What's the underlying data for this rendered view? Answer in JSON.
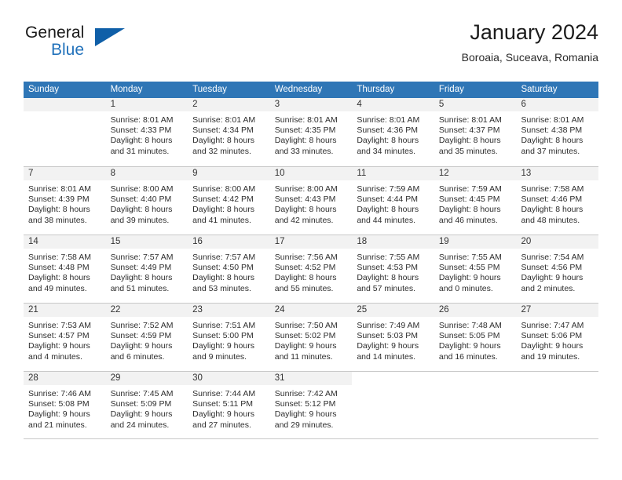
{
  "brand": {
    "name_top": "General",
    "name_bottom": "Blue",
    "triangle_color": "#0f5fa8",
    "blue_color": "#2272bb"
  },
  "header": {
    "title": "January 2024",
    "subtitle": "Boroaia, Suceava, Romania"
  },
  "theme": {
    "header_bg": "#2f76b6",
    "daynum_bg": "#f2f2f2",
    "grid_line": "#c8c8c8"
  },
  "weekdays": [
    "Sunday",
    "Monday",
    "Tuesday",
    "Wednesday",
    "Thursday",
    "Friday",
    "Saturday"
  ],
  "weeks": [
    [
      {
        "day": "",
        "sunrise": "",
        "sunset": "",
        "daylight1": "",
        "daylight2": ""
      },
      {
        "day": "1",
        "sunrise": "Sunrise: 8:01 AM",
        "sunset": "Sunset: 4:33 PM",
        "daylight1": "Daylight: 8 hours",
        "daylight2": "and 31 minutes."
      },
      {
        "day": "2",
        "sunrise": "Sunrise: 8:01 AM",
        "sunset": "Sunset: 4:34 PM",
        "daylight1": "Daylight: 8 hours",
        "daylight2": "and 32 minutes."
      },
      {
        "day": "3",
        "sunrise": "Sunrise: 8:01 AM",
        "sunset": "Sunset: 4:35 PM",
        "daylight1": "Daylight: 8 hours",
        "daylight2": "and 33 minutes."
      },
      {
        "day": "4",
        "sunrise": "Sunrise: 8:01 AM",
        "sunset": "Sunset: 4:36 PM",
        "daylight1": "Daylight: 8 hours",
        "daylight2": "and 34 minutes."
      },
      {
        "day": "5",
        "sunrise": "Sunrise: 8:01 AM",
        "sunset": "Sunset: 4:37 PM",
        "daylight1": "Daylight: 8 hours",
        "daylight2": "and 35 minutes."
      },
      {
        "day": "6",
        "sunrise": "Sunrise: 8:01 AM",
        "sunset": "Sunset: 4:38 PM",
        "daylight1": "Daylight: 8 hours",
        "daylight2": "and 37 minutes."
      }
    ],
    [
      {
        "day": "7",
        "sunrise": "Sunrise: 8:01 AM",
        "sunset": "Sunset: 4:39 PM",
        "daylight1": "Daylight: 8 hours",
        "daylight2": "and 38 minutes."
      },
      {
        "day": "8",
        "sunrise": "Sunrise: 8:00 AM",
        "sunset": "Sunset: 4:40 PM",
        "daylight1": "Daylight: 8 hours",
        "daylight2": "and 39 minutes."
      },
      {
        "day": "9",
        "sunrise": "Sunrise: 8:00 AM",
        "sunset": "Sunset: 4:42 PM",
        "daylight1": "Daylight: 8 hours",
        "daylight2": "and 41 minutes."
      },
      {
        "day": "10",
        "sunrise": "Sunrise: 8:00 AM",
        "sunset": "Sunset: 4:43 PM",
        "daylight1": "Daylight: 8 hours",
        "daylight2": "and 42 minutes."
      },
      {
        "day": "11",
        "sunrise": "Sunrise: 7:59 AM",
        "sunset": "Sunset: 4:44 PM",
        "daylight1": "Daylight: 8 hours",
        "daylight2": "and 44 minutes."
      },
      {
        "day": "12",
        "sunrise": "Sunrise: 7:59 AM",
        "sunset": "Sunset: 4:45 PM",
        "daylight1": "Daylight: 8 hours",
        "daylight2": "and 46 minutes."
      },
      {
        "day": "13",
        "sunrise": "Sunrise: 7:58 AM",
        "sunset": "Sunset: 4:46 PM",
        "daylight1": "Daylight: 8 hours",
        "daylight2": "and 48 minutes."
      }
    ],
    [
      {
        "day": "14",
        "sunrise": "Sunrise: 7:58 AM",
        "sunset": "Sunset: 4:48 PM",
        "daylight1": "Daylight: 8 hours",
        "daylight2": "and 49 minutes."
      },
      {
        "day": "15",
        "sunrise": "Sunrise: 7:57 AM",
        "sunset": "Sunset: 4:49 PM",
        "daylight1": "Daylight: 8 hours",
        "daylight2": "and 51 minutes."
      },
      {
        "day": "16",
        "sunrise": "Sunrise: 7:57 AM",
        "sunset": "Sunset: 4:50 PM",
        "daylight1": "Daylight: 8 hours",
        "daylight2": "and 53 minutes."
      },
      {
        "day": "17",
        "sunrise": "Sunrise: 7:56 AM",
        "sunset": "Sunset: 4:52 PM",
        "daylight1": "Daylight: 8 hours",
        "daylight2": "and 55 minutes."
      },
      {
        "day": "18",
        "sunrise": "Sunrise: 7:55 AM",
        "sunset": "Sunset: 4:53 PM",
        "daylight1": "Daylight: 8 hours",
        "daylight2": "and 57 minutes."
      },
      {
        "day": "19",
        "sunrise": "Sunrise: 7:55 AM",
        "sunset": "Sunset: 4:55 PM",
        "daylight1": "Daylight: 9 hours",
        "daylight2": "and 0 minutes."
      },
      {
        "day": "20",
        "sunrise": "Sunrise: 7:54 AM",
        "sunset": "Sunset: 4:56 PM",
        "daylight1": "Daylight: 9 hours",
        "daylight2": "and 2 minutes."
      }
    ],
    [
      {
        "day": "21",
        "sunrise": "Sunrise: 7:53 AM",
        "sunset": "Sunset: 4:57 PM",
        "daylight1": "Daylight: 9 hours",
        "daylight2": "and 4 minutes."
      },
      {
        "day": "22",
        "sunrise": "Sunrise: 7:52 AM",
        "sunset": "Sunset: 4:59 PM",
        "daylight1": "Daylight: 9 hours",
        "daylight2": "and 6 minutes."
      },
      {
        "day": "23",
        "sunrise": "Sunrise: 7:51 AM",
        "sunset": "Sunset: 5:00 PM",
        "daylight1": "Daylight: 9 hours",
        "daylight2": "and 9 minutes."
      },
      {
        "day": "24",
        "sunrise": "Sunrise: 7:50 AM",
        "sunset": "Sunset: 5:02 PM",
        "daylight1": "Daylight: 9 hours",
        "daylight2": "and 11 minutes."
      },
      {
        "day": "25",
        "sunrise": "Sunrise: 7:49 AM",
        "sunset": "Sunset: 5:03 PM",
        "daylight1": "Daylight: 9 hours",
        "daylight2": "and 14 minutes."
      },
      {
        "day": "26",
        "sunrise": "Sunrise: 7:48 AM",
        "sunset": "Sunset: 5:05 PM",
        "daylight1": "Daylight: 9 hours",
        "daylight2": "and 16 minutes."
      },
      {
        "day": "27",
        "sunrise": "Sunrise: 7:47 AM",
        "sunset": "Sunset: 5:06 PM",
        "daylight1": "Daylight: 9 hours",
        "daylight2": "and 19 minutes."
      }
    ],
    [
      {
        "day": "28",
        "sunrise": "Sunrise: 7:46 AM",
        "sunset": "Sunset: 5:08 PM",
        "daylight1": "Daylight: 9 hours",
        "daylight2": "and 21 minutes."
      },
      {
        "day": "29",
        "sunrise": "Sunrise: 7:45 AM",
        "sunset": "Sunset: 5:09 PM",
        "daylight1": "Daylight: 9 hours",
        "daylight2": "and 24 minutes."
      },
      {
        "day": "30",
        "sunrise": "Sunrise: 7:44 AM",
        "sunset": "Sunset: 5:11 PM",
        "daylight1": "Daylight: 9 hours",
        "daylight2": "and 27 minutes."
      },
      {
        "day": "31",
        "sunrise": "Sunrise: 7:42 AM",
        "sunset": "Sunset: 5:12 PM",
        "daylight1": "Daylight: 9 hours",
        "daylight2": "and 29 minutes."
      },
      {
        "day": "",
        "sunrise": "",
        "sunset": "",
        "daylight1": "",
        "daylight2": ""
      },
      {
        "day": "",
        "sunrise": "",
        "sunset": "",
        "daylight1": "",
        "daylight2": ""
      },
      {
        "day": "",
        "sunrise": "",
        "sunset": "",
        "daylight1": "",
        "daylight2": ""
      }
    ]
  ]
}
